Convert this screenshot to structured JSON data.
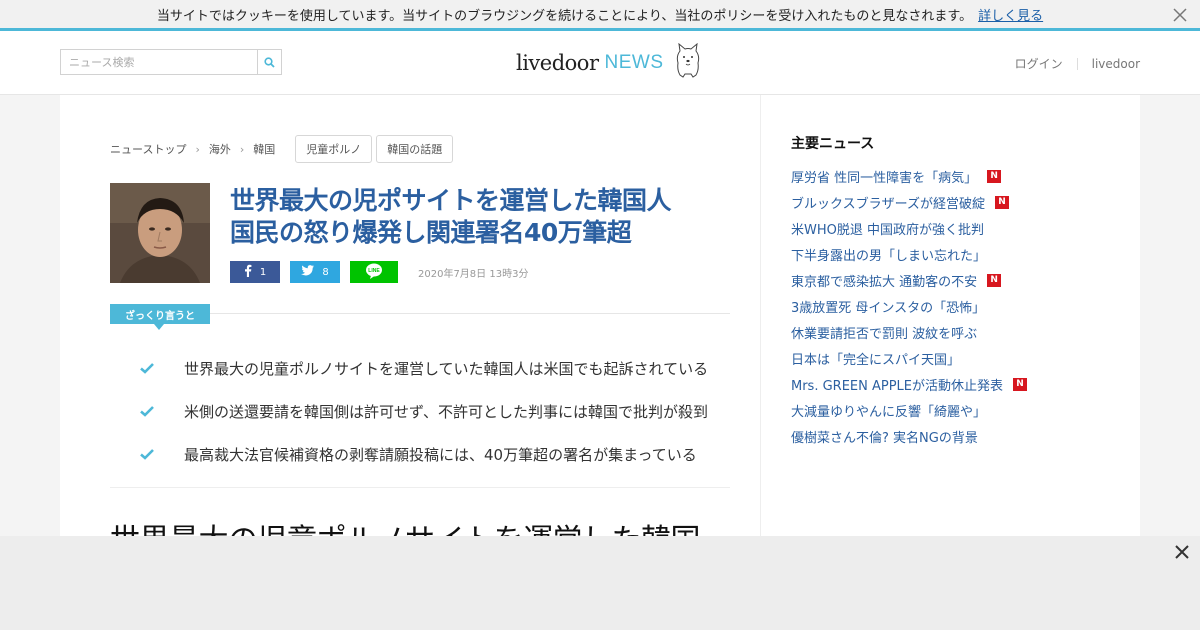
{
  "cookie": {
    "message": "当サイトではクッキーを使用しています。当サイトのブラウジングを続けることにより、当社のポリシーを受け入れたものと見なされます。",
    "link": "詳しく見る",
    "close_icon": "close-icon"
  },
  "header": {
    "search_placeholder": "ニュース検索",
    "logo_main": "livedoor",
    "logo_news": "NEWS",
    "login": "ログイン",
    "livedoor": "livedoor"
  },
  "breadcrumb": {
    "items": [
      "ニューストップ",
      "海外",
      "韓国"
    ],
    "tags": [
      "児童ポルノ",
      "韓国の話題"
    ]
  },
  "article": {
    "title_line1": "世界最大の児ポサイトを運営した韓国人",
    "title_line2": "国民の怒り爆発し関連署名40万筆超",
    "share": {
      "facebook_count": "1",
      "twitter_count": "8"
    },
    "date": "2020年7月8日 13時3分",
    "summary_label": "ざっくり言うと",
    "summary": [
      "世界最大の児童ポルノサイトを運営していた韓国人は米国でも起訴されている",
      "米側の送還要請を韓国側は許可せず、不許可とした判事には韓国で批判が殺到",
      "最高裁大法官候補資格の剥奪請願投稿には、40万筆超の署名が集まっている"
    ],
    "body_title": "世界最大の児童ポルノサイトを運営した韓国"
  },
  "sidebar": {
    "heading": "主要ニュース",
    "badge": "N",
    "items": [
      {
        "title": "厚労省 性同一性障害を「病気」",
        "new": true
      },
      {
        "title": "ブルックスブラザーズが経営破綻",
        "new": true
      },
      {
        "title": "米WHO脱退 中国政府が強く批判",
        "new": false
      },
      {
        "title": "下半身露出の男「しまい忘れた」",
        "new": false
      },
      {
        "title": "東京都で感染拡大 通勤客の不安",
        "new": true
      },
      {
        "title": "3歳放置死 母インスタの「恐怖」",
        "new": false
      },
      {
        "title": "休業要請拒否で罰則 波紋を呼ぶ",
        "new": false
      },
      {
        "title": "日本は「完全にスパイ天国」",
        "new": false
      },
      {
        "title": "Mrs. GREEN APPLEが活動休止発表",
        "new": true
      },
      {
        "title": "大減量ゆりやんに反響「綺麗や」",
        "new": false
      },
      {
        "title": "優樹菜さん不倫? 実名NGの背景",
        "new": false
      }
    ]
  },
  "colors": {
    "accent": "#4db8d8",
    "link": "#2b5fa0",
    "badge": "#d7171f",
    "facebook": "#3b5998",
    "twitter": "#2fa7e0",
    "line": "#00c300"
  }
}
